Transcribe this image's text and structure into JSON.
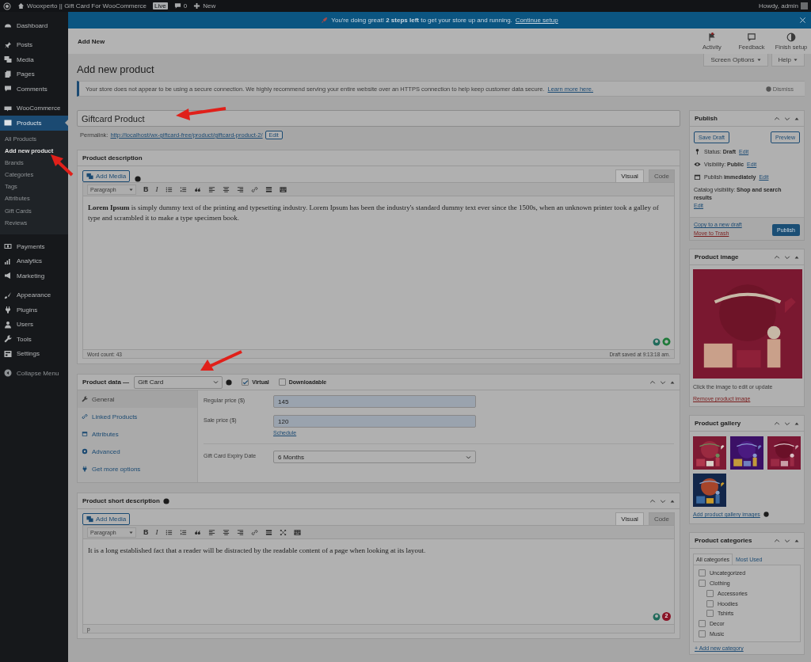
{
  "admin_bar": {
    "site_name": "Wooxperto || Gift Card For WooCommerce",
    "live_badge": "Live",
    "comments_count": "0",
    "new_label": "New",
    "greeting": "Howdy, admin"
  },
  "setup_banner": {
    "text": "You're doing great! **2 steps left** to get your store up and running.",
    "link": "Continue setup"
  },
  "sidebar": {
    "groups": [
      {
        "items": [
          {
            "label": "Dashboard",
            "selected": false
          }
        ]
      },
      {
        "items": [
          {
            "label": "Posts",
            "selected": false
          },
          {
            "label": "Media",
            "selected": false
          },
          {
            "label": "Pages",
            "selected": false
          },
          {
            "label": "Comments",
            "selected": false
          }
        ]
      },
      {
        "items": [
          {
            "label": "WooCommerce",
            "selected": false
          },
          {
            "label": "Products",
            "selected": true,
            "children": [
              {
                "label": "All Products",
                "selected": false
              },
              {
                "label": "Add new product",
                "selected": true
              },
              {
                "label": "Brands",
                "selected": false
              },
              {
                "label": "Categories",
                "selected": false
              },
              {
                "label": "Tags",
                "selected": false
              },
              {
                "label": "Attributes",
                "selected": false
              },
              {
                "label": "Gift Cards",
                "selected": false
              },
              {
                "label": "Reviews",
                "selected": false
              }
            ]
          }
        ]
      },
      {
        "items": [
          {
            "label": "Payments",
            "selected": false
          },
          {
            "label": "Analytics",
            "selected": false
          },
          {
            "label": "Marketing",
            "selected": false
          }
        ]
      },
      {
        "items": [
          {
            "label": "Appearance",
            "selected": false
          },
          {
            "label": "Plugins",
            "selected": false
          },
          {
            "label": "Users",
            "selected": false
          },
          {
            "label": "Tools",
            "selected": false
          },
          {
            "label": "Settings",
            "selected": false
          }
        ]
      }
    ],
    "collapse": "Collapse Menu"
  },
  "page_header": {
    "breadcrumb": "Add New",
    "actions": [
      {
        "label": "Activity",
        "unread": true
      },
      {
        "label": "Feedback"
      },
      {
        "label": "Finish setup"
      }
    ]
  },
  "screen_options": "Screen Options",
  "help": "Help",
  "page_title": "Add new product",
  "notice": {
    "text": "Your store does not appear to be using a secure connection. We highly recommend serving your entire website over an HTTPS connection to help keep customer data secure.",
    "link": "Learn more here.",
    "dismiss": "Dismiss"
  },
  "title_field": {
    "value": "Giftcard Product"
  },
  "permalink": {
    "label": "Permalink:",
    "url": "http://localhost/wx-giftcard-free/product/giftcard-product-2/",
    "edit": "Edit"
  },
  "description_box": {
    "title": "Product description",
    "add_media": "Add Media",
    "tabs": [
      {
        "label": "Visual",
        "selected": true
      },
      {
        "label": "Code",
        "selected": false
      }
    ],
    "format": "Paragraph",
    "text_buttons": [
      "B",
      "I"
    ],
    "fullscreen_button": false,
    "content": "**Lorem Ipsum** is simply dummy text of the printing and typesetting industry. Lorem Ipsum has been the industry's standard dummy text ever since the 1500s, when an unknown printer took a galley of type and scrambled it to make a type specimen book.",
    "word_count": "Word count: 43",
    "saved": "Draft saved at 9:13:18 am."
  },
  "product_data": {
    "title": "Product data —",
    "type": "Gift Card",
    "options": [
      {
        "label": "Virtual",
        "checked": true
      },
      {
        "label": "Downloadable",
        "checked": false
      }
    ],
    "tabs": [
      {
        "label": "General",
        "selected": true
      },
      {
        "label": "Linked Products",
        "selected": false
      },
      {
        "label": "Attributes",
        "selected": false
      },
      {
        "label": "Advanced",
        "selected": false
      },
      {
        "label": "Get more options",
        "selected": false
      }
    ],
    "fields": [
      {
        "kind": "text",
        "label": "Regular price ($)",
        "value": "145"
      },
      {
        "kind": "text",
        "label": "Sale price ($)",
        "value": "120",
        "link": "Schedule"
      },
      {
        "kind": "select",
        "label": "Gift Card Expiry Date",
        "value": "6 Months"
      }
    ]
  },
  "short_description": {
    "title": "Product short description",
    "add_media": "Add Media",
    "tabs": [
      {
        "label": "Visual",
        "selected": true
      },
      {
        "label": "Code",
        "selected": false
      }
    ],
    "format": "Paragraph",
    "text_buttons": [
      "B",
      "I"
    ],
    "fullscreen_button": true,
    "content": "It is a long established fact that a reader will be distracted by the readable content of a page when looking at its layout.",
    "path": "p",
    "issues_count": "2"
  },
  "publish": {
    "title": "Publish",
    "save_draft": "Save Draft",
    "preview": "Preview",
    "rows": [
      {
        "text": "Status: **Draft**",
        "edit": "Edit"
      },
      {
        "text": "Visibility: **Public**",
        "edit": "Edit"
      },
      {
        "text": "Publish **immediately**",
        "edit": "Edit"
      }
    ],
    "catalog": {
      "text": "Catalog visibility: **Shop and search results**",
      "edit": "Edit"
    },
    "copy": "Copy to a new draft",
    "trash": "Move to Trash",
    "publish_button": "Publish"
  },
  "product_image": {
    "title": "Product image",
    "hint": "Click the image to edit or update",
    "remove": "Remove product image"
  },
  "gallery": {
    "title": "Product gallery",
    "add_link": "Add product gallery images"
  },
  "categories": {
    "title": "Product categories",
    "tabs": [
      {
        "label": "All categories",
        "selected": true
      },
      {
        "label": "Most Used",
        "selected": false
      }
    ],
    "items": [
      {
        "label": "Uncategorized",
        "checked": false
      },
      {
        "label": "Clothing",
        "checked": false,
        "children": [
          {
            "label": "Accessories",
            "checked": false
          },
          {
            "label": "Hoodies",
            "checked": false
          },
          {
            "label": "Tshirts",
            "checked": false
          }
        ]
      },
      {
        "label": "Decor",
        "checked": false
      },
      {
        "label": "Music",
        "checked": false
      }
    ],
    "add_link": "+ Add new category"
  }
}
